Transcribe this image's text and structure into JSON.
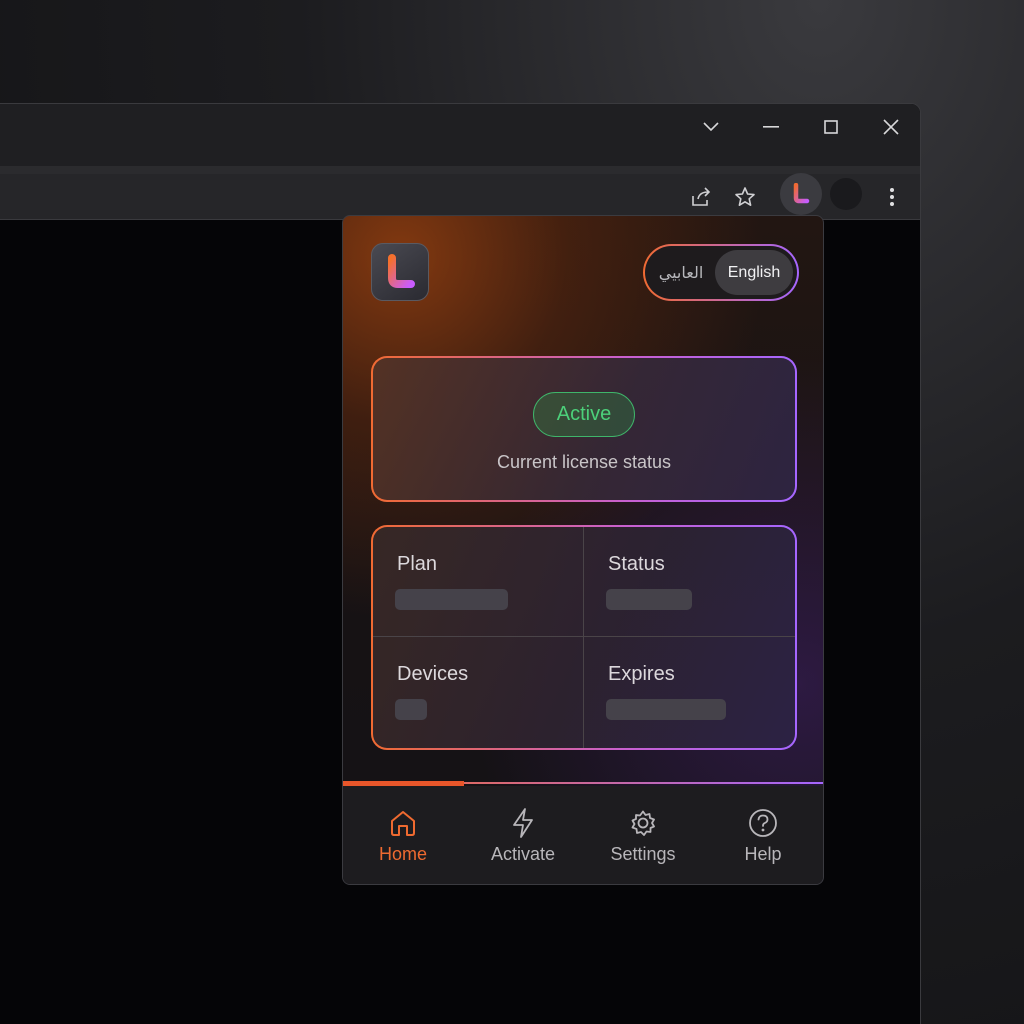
{
  "browser": {
    "window_controls": [
      "chevron-down-icon",
      "minimize-icon",
      "maximize-icon",
      "close-icon"
    ],
    "toolbar_icons": [
      "share-icon",
      "star-icon",
      "extension-icon",
      "profile-icon",
      "more-vert-icon"
    ]
  },
  "popup": {
    "logo_letter": "L",
    "language": {
      "arabic_label": "العابيي",
      "english_label": "English",
      "selected": "English"
    },
    "license": {
      "status_badge": "Active",
      "caption": "Current license status",
      "badge_color": "#4cd07a"
    },
    "details": [
      {
        "label": "Plan"
      },
      {
        "label": "Status"
      },
      {
        "label": "Devices"
      },
      {
        "label": "Expires"
      }
    ],
    "nav": {
      "items": [
        {
          "label": "Home",
          "icon": "home-icon",
          "active": true
        },
        {
          "label": "Activate",
          "icon": "bolt-icon",
          "active": false
        },
        {
          "label": "Settings",
          "icon": "gear-icon",
          "active": false
        },
        {
          "label": "Help",
          "icon": "help-icon",
          "active": false
        }
      ],
      "active_color": "#ef6a30"
    },
    "accent_gradient": [
      "#f06a32",
      "#a566ff"
    ]
  }
}
